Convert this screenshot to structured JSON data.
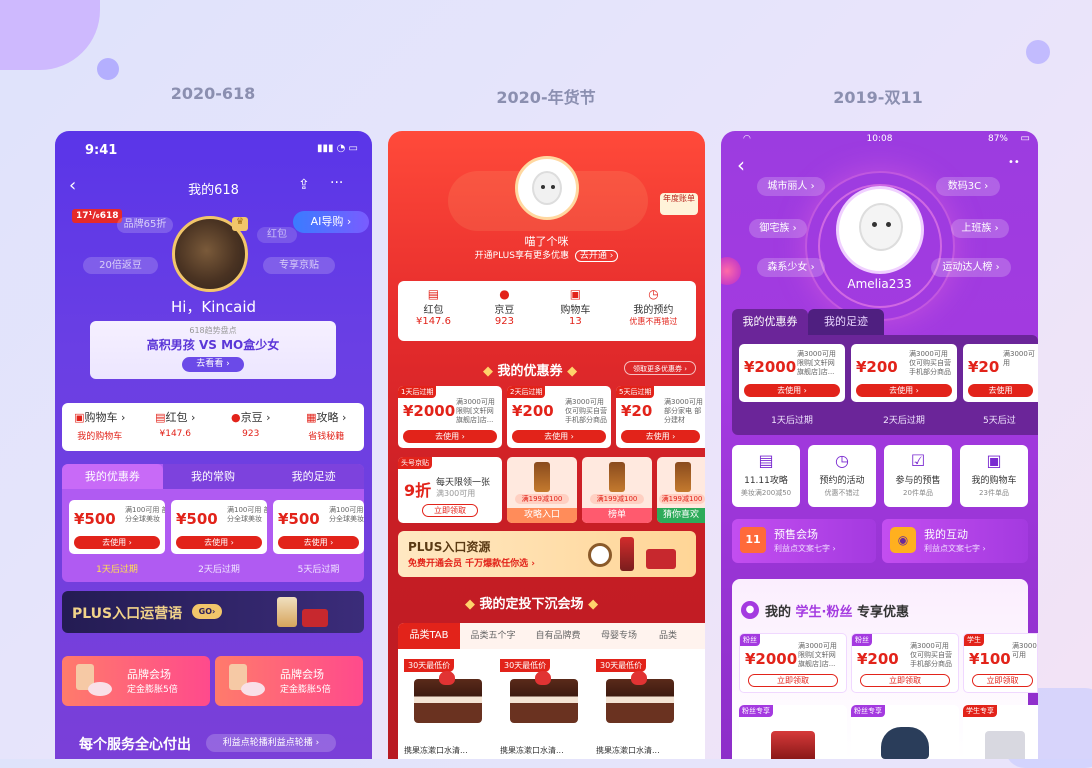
{
  "titles": [
    "2020-618",
    "2020-年货节",
    "2019-双11"
  ],
  "p1": {
    "time": "9:41",
    "nav_title": "我的618",
    "badge_618": "17¹/₆618",
    "ai_btn": "AI导购 ›",
    "side_tags": [
      "品牌65折",
      "红包",
      "20倍返豆",
      "专享京贴"
    ],
    "greeting": "Hi，Kincaid",
    "banner": {
      "sub": "618趋势盘点",
      "title": "高积男孩 VS MO盒少女",
      "btn": "去看看 ›"
    },
    "shortcuts": [
      {
        "name": "购物车 ›",
        "value": "我的购物车",
        "icon": "cart-icon"
      },
      {
        "name": "红包 ›",
        "value": "¥147.6",
        "icon": "redpacket-icon"
      },
      {
        "name": "京豆 ›",
        "value": "923",
        "icon": "bean-icon"
      },
      {
        "name": "攻略 ›",
        "value": "省钱秘籍",
        "icon": "guide-icon"
      }
    ],
    "tabs": [
      "我的优惠券",
      "我的常购",
      "我的足迹"
    ],
    "coupons": [
      {
        "amount": "¥500",
        "desc": "满100可用 部分全球美妆",
        "btn": "去使用 ›",
        "expire": "1天后过期"
      },
      {
        "amount": "¥500",
        "desc": "满100可用 部分全球美妆",
        "btn": "去使用 ›",
        "expire": "2天后过期"
      },
      {
        "amount": "¥500",
        "desc": "满100可用 部分全球美妆",
        "btn": "去使用 ›",
        "expire": "5天后过期"
      }
    ],
    "plus": {
      "text": "PLUS入口运营语",
      "go": "GO›"
    },
    "brand_cards": [
      {
        "title": "品牌会场",
        "sub": "定金膨胀5倍"
      },
      {
        "title": "品牌会场",
        "sub": "定金膨胀5倍"
      }
    ],
    "bottom": {
      "title": "每个服务全心付出",
      "tag": "利益点轮播利益点轮播 ›"
    }
  },
  "p2": {
    "mascot_name": "喵了个咪",
    "plus_line": "开通PLUS享有更多优惠",
    "plus_btn": "去开通 ›",
    "year_badge": "年度账单",
    "stats": [
      {
        "label": "红包",
        "value": "¥147.6",
        "icon": "redpacket-icon"
      },
      {
        "label": "京豆",
        "value": "923",
        "icon": "bean-icon"
      },
      {
        "label": "购物车",
        "value": "13",
        "icon": "cart-icon"
      },
      {
        "label": "我的预约",
        "value": "优惠不再错过",
        "icon": "alarm-icon"
      }
    ],
    "coupon_section": "我的优惠券",
    "more_coupons": "领取更多优惠券 ›",
    "coupons": [
      {
        "flag": "1天后过期",
        "amount": "¥2000",
        "desc": "满3000可用 限购[文轩网 旗舰店]店...",
        "btn": "去使用 ›"
      },
      {
        "flag": "2天后过期",
        "amount": "¥200",
        "desc": "满3000可用 仅可购买自营 手机部分商品",
        "btn": "去使用 ›"
      },
      {
        "flag": "5天后过期",
        "amount": "¥20",
        "desc": "满3000可用 部分家电 部分建材",
        "btn": "去使用 ›"
      }
    ],
    "promo": {
      "flag": "头号京贴",
      "big": "9折",
      "line1": "每天限领一张",
      "line2": "满300可用",
      "btn": "立即领取"
    },
    "products": [
      {
        "tag": "满199减100",
        "label": "攻略入口"
      },
      {
        "tag": "满199减100",
        "label": "榜单"
      },
      {
        "tag": "满199减100",
        "label": "猜你喜欢"
      }
    ],
    "plus_res": {
      "title": "PLUS入口资源",
      "sub": "免费开通会员 千万爆款任你选 ›"
    },
    "section2": "我的定投下沉会场",
    "tabs": [
      "品类TAB",
      "品类五个字",
      "自有品牌费",
      "母婴专场",
      "品类"
    ],
    "goods": [
      {
        "flag": "30天最低价",
        "name": "携果冻漱口水清..."
      },
      {
        "flag": "30天最低价",
        "name": "携果冻漱口水清..."
      },
      {
        "flag": "30天最低价",
        "name": "携果冻漱口水清..."
      }
    ]
  },
  "p3": {
    "time": "10:08",
    "battery": "87%",
    "tags_left": [
      "城市丽人 ›",
      "御宅族 ›",
      "森系少女 ›"
    ],
    "tags_right": [
      "数码3C ›",
      "上班族 ›",
      "运动达人榜 ›"
    ],
    "username": "Amelia233",
    "tabs": [
      "我的优惠券",
      "我的足迹"
    ],
    "coupons": [
      {
        "amount": "¥2000",
        "desc": "满3000可用 限购[文轩网 旗舰店]店...",
        "btn": "去使用 ›",
        "expire": "1天后过期"
      },
      {
        "amount": "¥200",
        "desc": "满3000可用 仅可购买自营 手机部分商品",
        "btn": "去使用 ›",
        "expire": "2天后过期"
      },
      {
        "amount": "¥20",
        "desc": "满3000可用",
        "btn": "去使用",
        "expire": "5天后过"
      }
    ],
    "grid": [
      {
        "title": "11.11攻略",
        "sub": "美妆满200减50",
        "icon": "book-icon"
      },
      {
        "title": "预约的活动",
        "sub": "优惠不错过",
        "icon": "alarm-icon"
      },
      {
        "title": "参与的预售",
        "sub": "20件单品",
        "icon": "calendar-check-icon"
      },
      {
        "title": "我的购物车",
        "sub": "23件单品",
        "icon": "cart-icon"
      }
    ],
    "wide": [
      {
        "title": "预售会场",
        "sub": "利益点文案七字 ›",
        "icon": "calendar-11-icon"
      },
      {
        "title": "我的互动",
        "sub": "利益点文案七字 ›",
        "icon": "game-icon"
      }
    ],
    "exclusive": {
      "pre": "我的 ",
      "hl": "学生·粉丝",
      "post": " 专享优惠"
    },
    "ex_coupons": [
      {
        "flag": "粉丝",
        "amount": "¥2000",
        "desc": "满3000可用 限购[文轩网 旗舰店]店...",
        "btn": "立即领取"
      },
      {
        "flag": "粉丝",
        "amount": "¥200",
        "desc": "满3000可用 仅可购买自营 手机部分商品",
        "btn": "立即领取"
      },
      {
        "flag": "学生",
        "amount": "¥100",
        "desc": "满3000可用",
        "btn": "立即领取"
      }
    ],
    "bottom_flags": [
      "粉丝专享",
      "粉丝专享",
      "学生专享"
    ]
  }
}
